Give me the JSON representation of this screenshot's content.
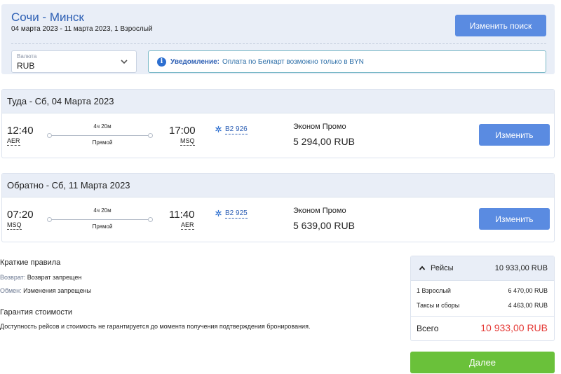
{
  "search": {
    "route": "Сочи - Минск",
    "details": "04 марта 2023 - 11 марта 2023, 1 Взрослый",
    "change_search_label": "Изменить поиск",
    "currency_label": "Валюта",
    "currency_value": "RUB",
    "notice_title": "Уведомление:",
    "notice_text": "Оплата по Белкарт возможно только в BYN"
  },
  "segments": [
    {
      "header": "Туда - Сб, 04 Марта 2023",
      "dep_time": "12:40",
      "dep_code": "AER",
      "duration": "4ч 20м",
      "stops": "Прямой",
      "arr_time": "17:00",
      "arr_code": "MSQ",
      "flight_no": "B2 926",
      "fare_name": "Эконом Промо",
      "price": "5 294,00 RUB",
      "change_label": "Изменить"
    },
    {
      "header": "Обратно - Сб, 11 Марта 2023",
      "dep_time": "07:20",
      "dep_code": "MSQ",
      "duration": "4ч 20м",
      "stops": "Прямой",
      "arr_time": "11:40",
      "arr_code": "AER",
      "flight_no": "B2 925",
      "fare_name": "Эконом Промо",
      "price": "5 639,00 RUB",
      "change_label": "Изменить"
    }
  ],
  "rules": {
    "title": "Краткие правила",
    "refund_key": "Возврат:",
    "refund_val": "Возврат запрещен",
    "exchange_key": "Обмен:",
    "exchange_val": "Изменения запрещены",
    "guarantee_title": "Гарантия стоимости",
    "guarantee_text": "Доступность рейсов и стоимость не гарантируется до момента получения подтверждения бронирования."
  },
  "summary": {
    "flights_label": "Рейсы",
    "flights_total": "10 933,00 RUB",
    "rows": [
      {
        "label": "1 Взрослый",
        "value": "6 470,00 RUB"
      },
      {
        "label": "Таксы и сборы",
        "value": "4 463,00 RUB"
      }
    ],
    "total_label": "Всего",
    "total_value": "10 933,00 RUB",
    "next_label": "Далее"
  },
  "colors": {
    "accent": "#5a8be1",
    "route_blue": "#2d5fb4",
    "panel_bg": "#e9eef7",
    "total_red": "#e53935",
    "next_green": "#6ac13a"
  },
  "icons": {
    "currency_dropdown": "chevron-down-icon",
    "notice": "info-icon",
    "flight": "airline-logo-icon",
    "summary_toggle": "chevron-up-icon"
  }
}
